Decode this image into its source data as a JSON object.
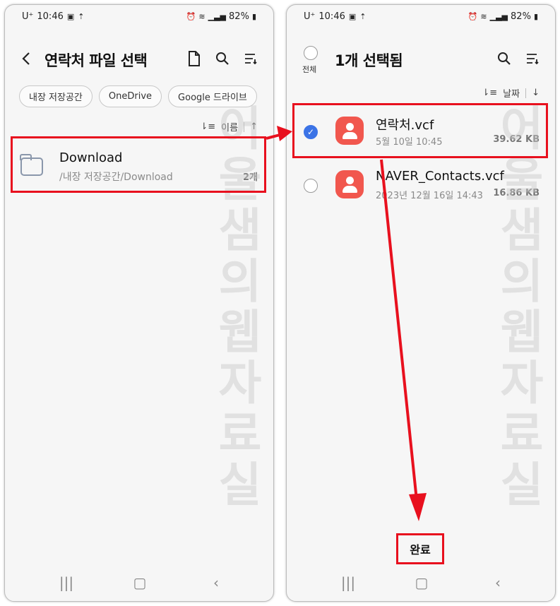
{
  "status_bar": {
    "carrier": "U⁺",
    "time": "10:46",
    "battery": "82%"
  },
  "left": {
    "title": "연락처 파일 선택",
    "chips": [
      "내장 저장공간",
      "OneDrive",
      "Google 드라이브"
    ],
    "sort_label": "이름",
    "folder": {
      "name": "Download",
      "path": "/내장 저장공간/Download",
      "count": "2개"
    }
  },
  "right": {
    "select_all_label": "전체",
    "title": "1개 선택됨",
    "sort_label": "날짜",
    "files": [
      {
        "name": "연락처.vcf",
        "date": "5월 10일 10:45",
        "size": "39.62 KB",
        "checked": true
      },
      {
        "name": "NAVER_Contacts.vcf",
        "date": "2023년 12월 16일 14:43",
        "size": "16.86 KB",
        "checked": false
      }
    ],
    "done_label": "완료"
  },
  "watermark": "어울샘의웹자료실",
  "colors": {
    "accent": "#3b73e6",
    "highlight": "#e8101e",
    "contact_icon": "#f1574e",
    "folder_icon": "#8a97ab"
  },
  "icons": {
    "status_left": [
      "image-icon",
      "upload-icon"
    ],
    "status_right": [
      "alarm-icon",
      "wifi-icon",
      "signal-icon",
      "battery-icon"
    ],
    "left_appbar": [
      "back-icon",
      "file-icon",
      "search-icon",
      "sort-menu-icon"
    ],
    "right_appbar": [
      "search-icon",
      "sort-menu-icon"
    ],
    "navbar": [
      "recents-icon",
      "home-icon",
      "back-icon"
    ]
  }
}
